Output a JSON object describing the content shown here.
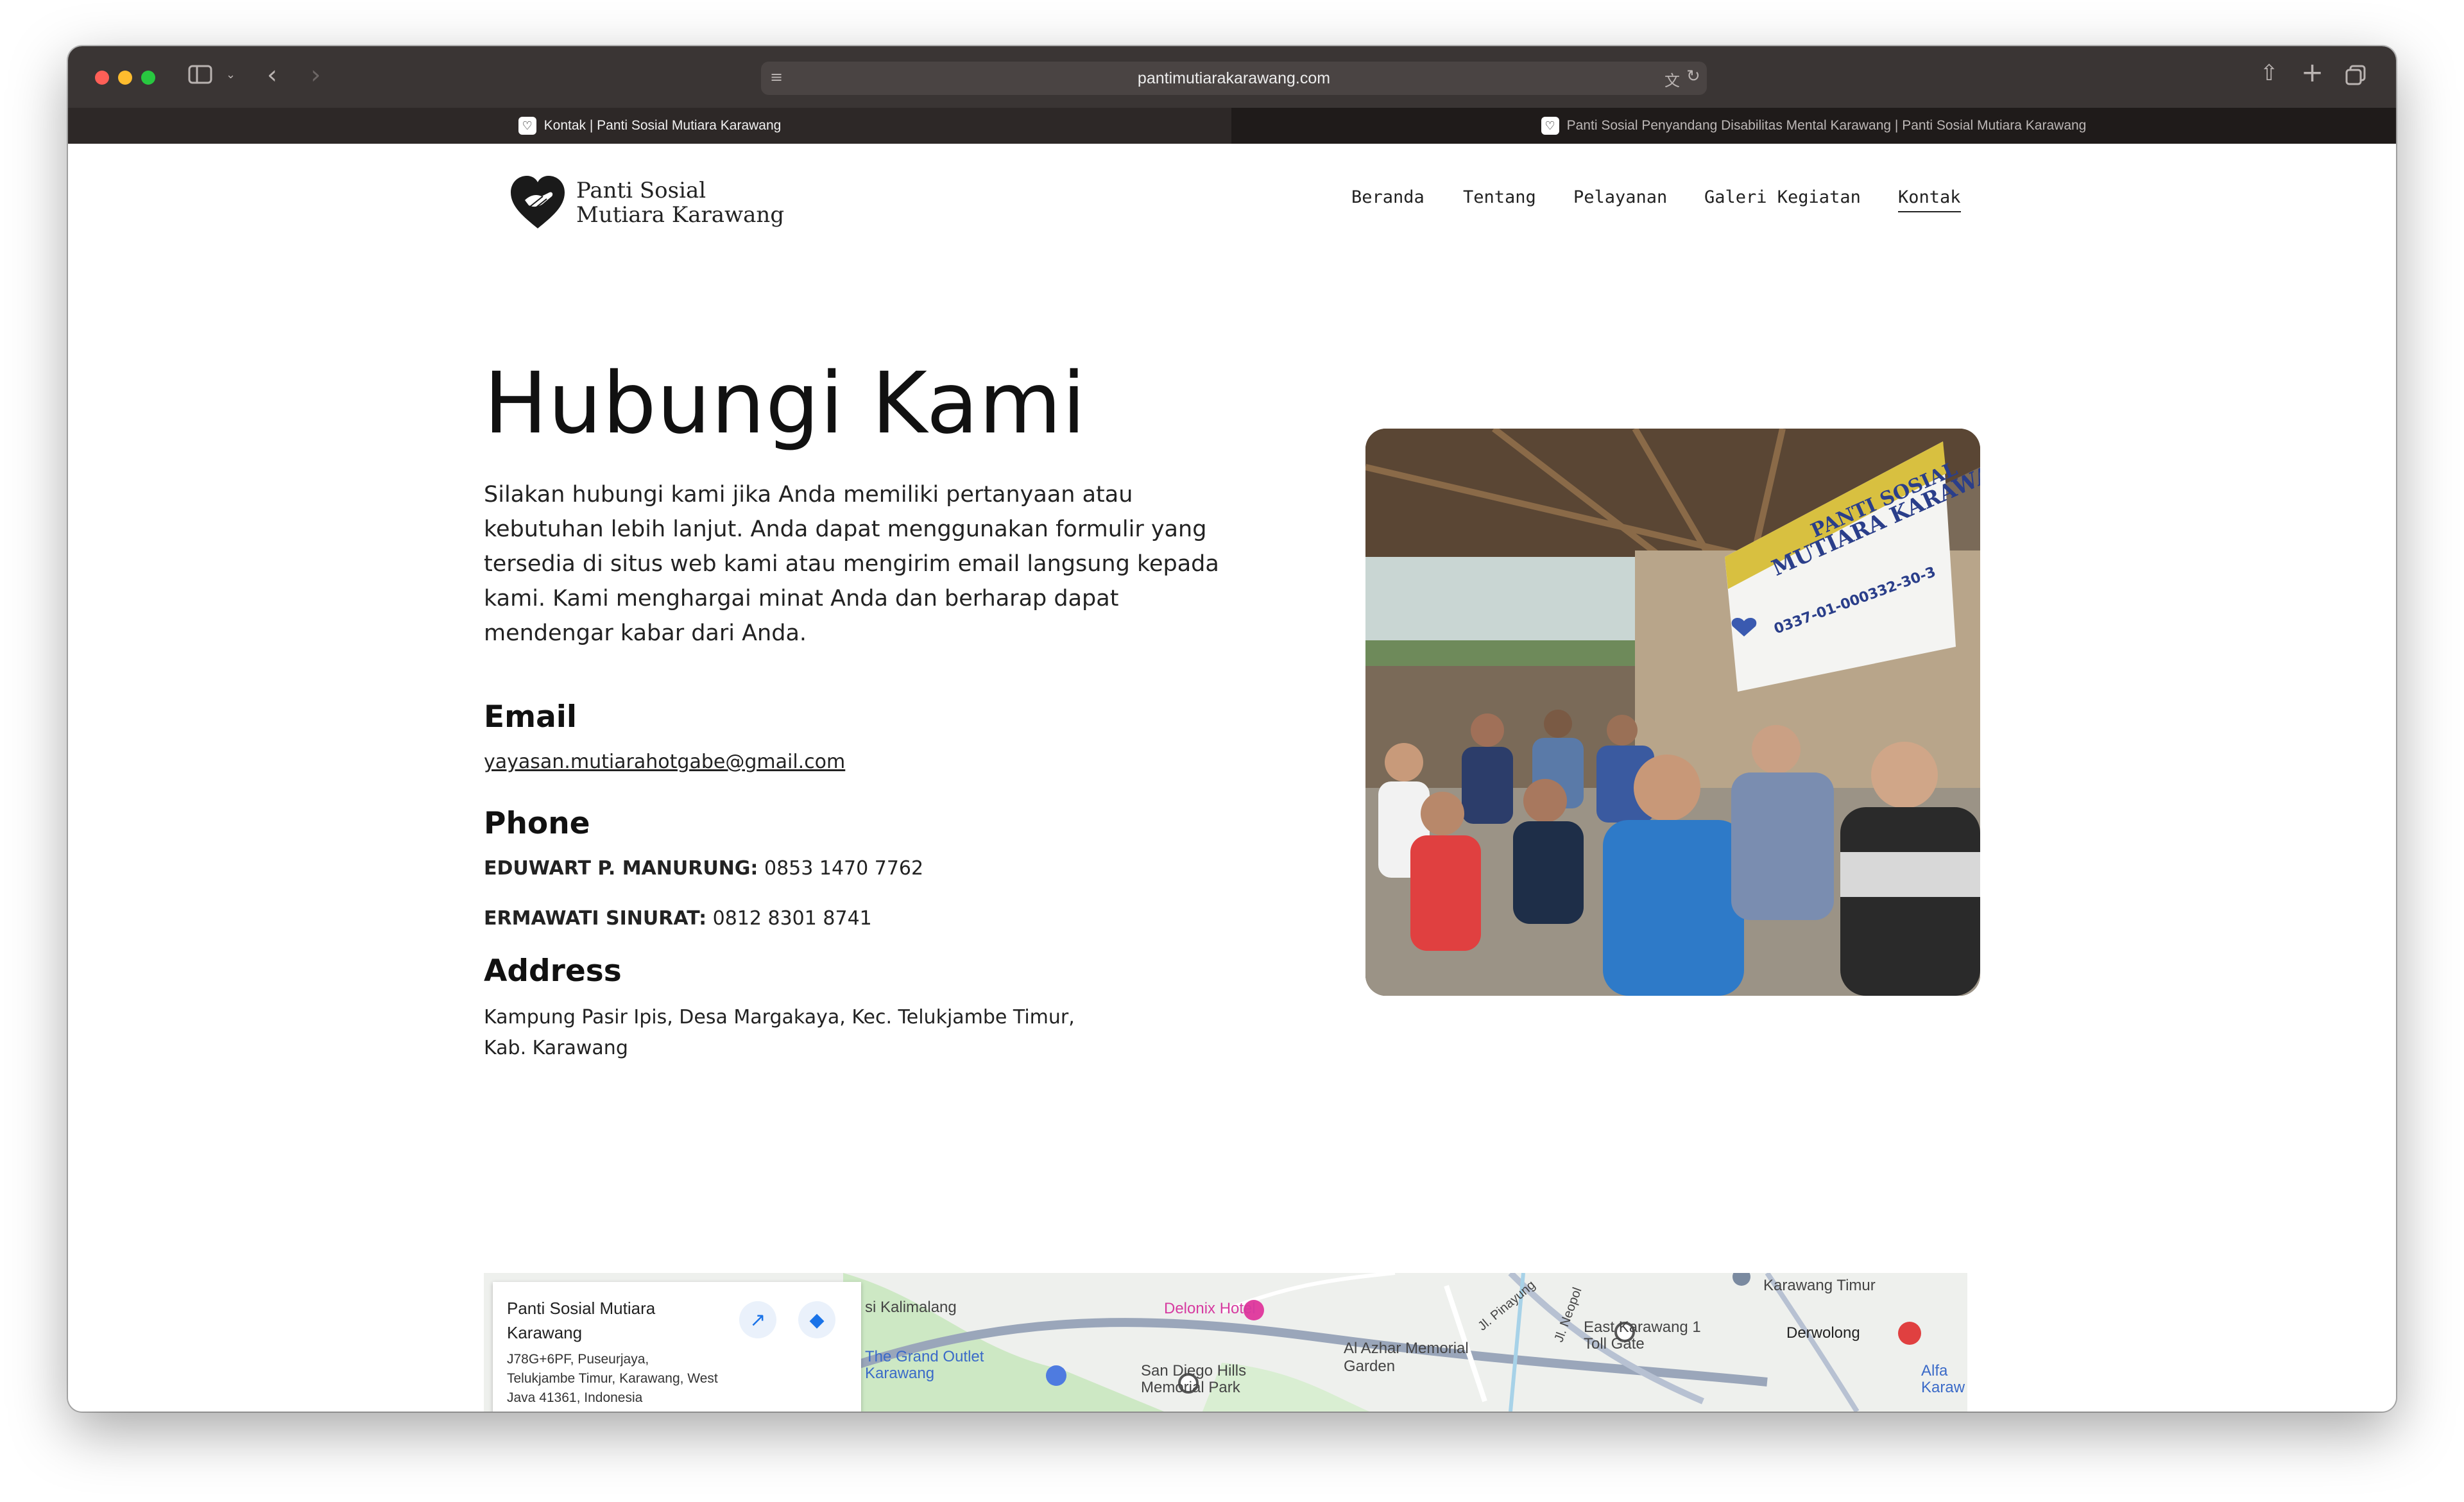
{
  "browser": {
    "url": "pantimutiarakarawang.com",
    "tabs": [
      {
        "label": "Kontak | Panti Sosial Mutiara Karawang",
        "active": true
      },
      {
        "label": "Panti Sosial Penyandang Disabilitas Mental Karawang | Panti Sosial Mutiara Karawang",
        "active": false
      }
    ]
  },
  "site": {
    "logo_line1": "Panti Sosial",
    "logo_line2": "Mutiara Karawang",
    "nav": [
      "Beranda",
      "Tentang",
      "Pelayanan",
      "Galeri Kegiatan",
      "Kontak"
    ],
    "active_nav": "Kontak"
  },
  "contact": {
    "title": "Hubungi Kami",
    "intro": "Silakan hubungi kami jika Anda memiliki pertanyaan atau kebutuhan lebih lanjut. Anda dapat menggunakan formulir yang tersedia di situs web kami atau mengirim email langsung kepada kami. Kami menghargai minat Anda dan berharap dapat mendengar kabar dari Anda.",
    "email_heading": "Email",
    "email": "yayasan.mutiarahotgabe@gmail.com",
    "phone_heading": "Phone",
    "phone1_name": "EDUWART P. MANURUNG:",
    "phone1_number": "0853 1470 7762",
    "phone2_name": "ERMAWATI SINURAT:",
    "phone2_number": "0812 8301 8741",
    "address_heading": "Address",
    "address_line1": "Kampung Pasir Ipis, Desa Margakaya, Kec. Telukjambe Timur,",
    "address_line2": "Kab. Karawang"
  },
  "photo": {
    "banner_line1": "PANTI SOSIAL",
    "banner_line2": "MUTIARA KARAWANG",
    "banner_bank": "0337-01-000332-30-3"
  },
  "map": {
    "place_title": "Panti Sosial Mutiara Karawang",
    "place_address": "J78G+6PF, Puseurjaya, Telukjambe Timur, Karawang, West Java 41361, Indonesia",
    "labels": [
      "si Kalimalang",
      "Delonix Hotel",
      "The Grand Outlet Karawang",
      "San Diego Hills Memorial Park",
      "Al Azhar Memorial Garden",
      "Jl. Pinayung",
      "Jl. Neopol",
      "East Karawang 1 Toll Gate",
      "Karawang Timur",
      "Derwolong",
      "Alfa Karaw"
    ]
  }
}
